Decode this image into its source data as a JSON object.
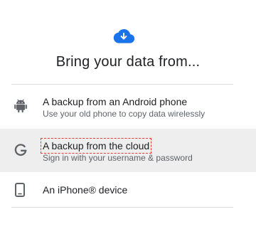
{
  "header": {
    "icon": "cloud-download-icon",
    "title": "Bring your data from..."
  },
  "options": [
    {
      "icon": "android-icon",
      "title": "A backup from an Android phone",
      "subtitle": "Use your old phone to copy data wirelessly"
    },
    {
      "icon": "google-g-icon",
      "title": "A backup from the cloud",
      "subtitle": "Sign in with your username & password",
      "selected": true
    },
    {
      "icon": "phone-outline-icon",
      "title": "An iPhone® device"
    }
  ],
  "colors": {
    "accent": "#1a73e8",
    "icon_gray": "#5f6368",
    "selected_bg": "#eeeeee",
    "divider": "#dadce0",
    "focus_outline": "#e53935"
  }
}
